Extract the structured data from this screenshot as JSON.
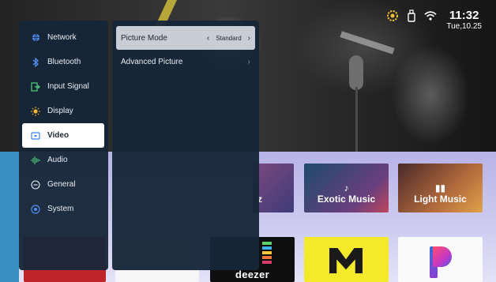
{
  "menu": {
    "items": [
      {
        "label": "Network",
        "icon": "globe-icon"
      },
      {
        "label": "Bluetooth",
        "icon": "bluetooth-icon"
      },
      {
        "label": "Input Signal",
        "icon": "input-signal-icon"
      },
      {
        "label": "Display",
        "icon": "display-sun-icon"
      },
      {
        "label": "Video",
        "icon": "video-icon"
      },
      {
        "label": "Audio",
        "icon": "audio-wave-icon"
      },
      {
        "label": "General",
        "icon": "general-icon"
      },
      {
        "label": "System",
        "icon": "system-icon"
      }
    ],
    "selected": "Video"
  },
  "submenu": {
    "picture_mode": {
      "label": "Picture Mode",
      "value": "Standard"
    },
    "advanced_picture": {
      "label": "Advanced Picture"
    }
  },
  "status": {
    "time": "11:32",
    "date": "Tue,10.25"
  },
  "tiles": {
    "partial_label": "z",
    "exotic_music": "Exotic Music",
    "light_music": "Light Music",
    "deezer": "deezer"
  },
  "colors": {
    "menu_bg": "#172638",
    "accent_blue": "#3b82f6",
    "status_icon_yellow": "#f2c230"
  }
}
